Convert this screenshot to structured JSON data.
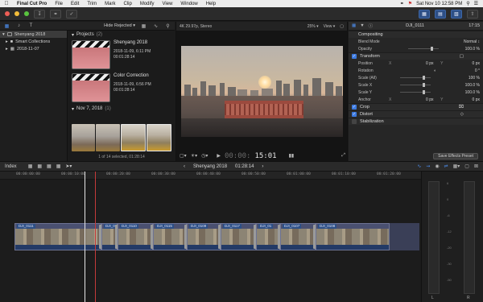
{
  "menubar": {
    "app_name": "Final Cut Pro",
    "items": [
      "File",
      "Edit",
      "Trim",
      "Mark",
      "Clip",
      "Modify",
      "View",
      "Window",
      "Help"
    ],
    "clock": "Sat Nov 10  12:58 PM"
  },
  "browser": {
    "filter_label": "Hide Rejected ▾",
    "libraries": [
      {
        "label": "Shenyang 2018",
        "selected": true
      },
      {
        "label": "Smart Collections",
        "selected": false
      },
      {
        "label": "2018-11-07",
        "selected": false
      }
    ],
    "projects_header": "Projects",
    "projects_count": "(2)",
    "projects": [
      {
        "name": "Shenyang 2018",
        "date": "2018-11-09, 6:11 PM",
        "duration": "00:01:28:14"
      },
      {
        "name": "Color Correction",
        "date": "2018-11-09, 6:56 PM",
        "duration": "00:01:28:14"
      }
    ],
    "event_header": "Nov 7, 2018",
    "event_count": "(1)",
    "status": "1 of 14 selected, 01:28:14"
  },
  "viewer": {
    "format": "4K 29.97p, Stereo",
    "zoom": "25% ▾",
    "view_menu": "View ▾",
    "timecode_dim": "00:00:",
    "timecode": "15:01"
  },
  "inspector": {
    "clip_name": "DJI_0111",
    "duration": "17:15",
    "compositing_label": "Compositing",
    "blend_mode_label": "Blend Mode",
    "blend_mode_value": "Normal ↕",
    "opacity_label": "Opacity",
    "opacity_value": "100.0 %",
    "transform_label": "Transform",
    "position_label": "Position",
    "position_x": "0 px",
    "position_y": "0 px",
    "rotation_label": "Rotation",
    "rotation_value": "0 °",
    "scale_all_label": "Scale (All)",
    "scale_all_value": "100 %",
    "scale_x_label": "Scale X",
    "scale_x_value": "100.0 %",
    "scale_y_label": "Scale Y",
    "scale_y_value": "100.0 %",
    "anchor_label": "Anchor",
    "anchor_x": "0 px",
    "anchor_y": "0 px",
    "crop_label": "Crop",
    "distort_label": "Distort",
    "stabilization_label": "Stabilization",
    "save_preset": "Save Effects Preset"
  },
  "timeline_bar": {
    "index": "Index",
    "project": "Shenyang 2018",
    "duration": "01:28:14"
  },
  "ruler_ticks": [
    "00:00:00:00",
    "00:00:10:00",
    "00:00:20:00",
    "00:00:30:00",
    "00:00:40:00",
    "00:00:50:00",
    "00:01:00:00",
    "00:01:10:00",
    "00:01:20:00",
    "00:01:30:00"
  ],
  "timeline_clips": [
    "DJI_0111",
    "DJI_01",
    "DJI_0110",
    "DJI_0115",
    "DJI_0109",
    "DJI_0117",
    "DJI_01",
    "DJI_0107",
    "DJI_0108"
  ],
  "meters": {
    "left": "L",
    "right": "R",
    "scale": [
      "6",
      "0",
      "-6",
      "-12",
      "-20",
      "-30",
      "-50"
    ]
  }
}
